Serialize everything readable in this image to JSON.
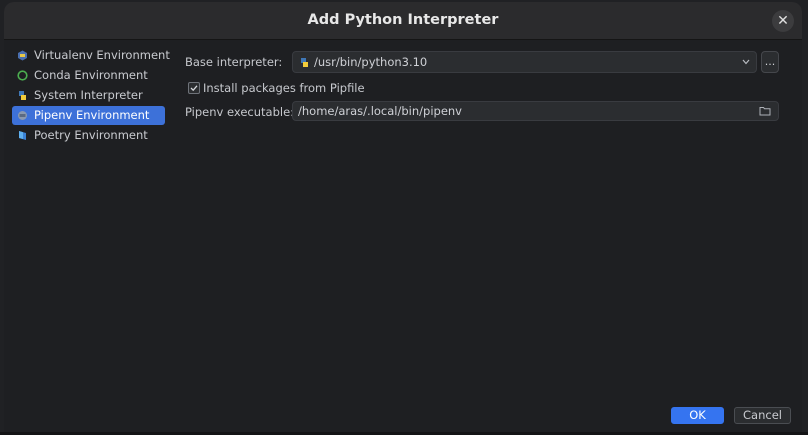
{
  "window": {
    "title": "Add Python Interpreter",
    "close_glyph": "✕"
  },
  "sidebar": {
    "items": [
      {
        "label": "Virtualenv Environment",
        "icon": "virtualenv-icon"
      },
      {
        "label": "Conda Environment",
        "icon": "conda-icon"
      },
      {
        "label": "System Interpreter",
        "icon": "python-icon"
      },
      {
        "label": "Pipenv Environment",
        "icon": "pipenv-icon",
        "selected": true
      },
      {
        "label": "Poetry Environment",
        "icon": "poetry-icon"
      }
    ]
  },
  "form": {
    "base_interpreter_label": "Base interpreter:",
    "base_interpreter_value": "/usr/bin/python3.10",
    "browse_label": "...",
    "install_checkbox_label": "Install packages from Pipfile",
    "install_checked": true,
    "pipenv_label": "Pipenv executable:",
    "pipenv_value": "/home/aras/.local/bin/pipenv"
  },
  "footer": {
    "ok_label": "OK",
    "cancel_label": "Cancel"
  },
  "colors": {
    "accent": "#3574f0",
    "selection": "#3d71d9",
    "background": "#1e1f22"
  }
}
